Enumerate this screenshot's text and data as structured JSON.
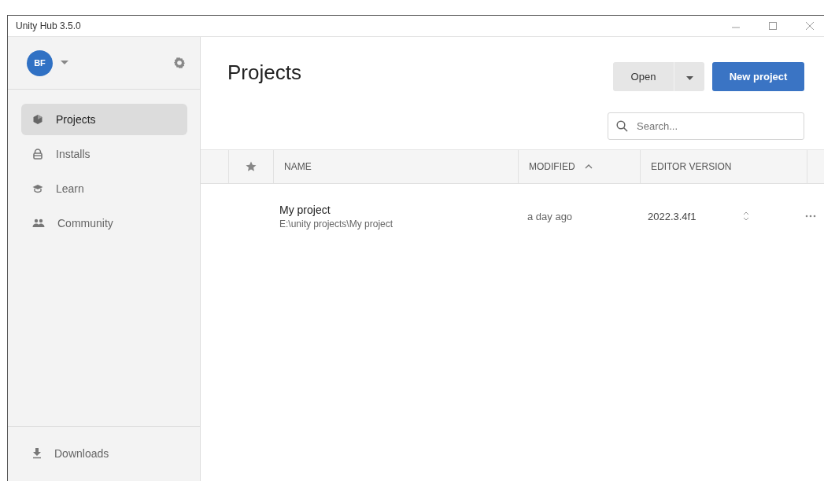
{
  "window": {
    "title": "Unity Hub 3.5.0"
  },
  "account": {
    "initials": "BF"
  },
  "sidebar": {
    "items": [
      {
        "label": "Projects",
        "selected": true
      },
      {
        "label": "Installs",
        "selected": false
      },
      {
        "label": "Learn",
        "selected": false
      },
      {
        "label": "Community",
        "selected": false
      }
    ],
    "footer": {
      "label": "Downloads"
    }
  },
  "page": {
    "title": "Projects",
    "open_button": "Open",
    "new_button": "New project",
    "search": {
      "placeholder": "Search..."
    }
  },
  "table": {
    "columns": [
      {
        "label": "NAME",
        "sorted": false
      },
      {
        "label": "MODIFIED",
        "sorted": true
      },
      {
        "label": "EDITOR VERSION",
        "sorted": false
      }
    ],
    "rows": [
      {
        "name": "My project",
        "path": "E:\\unity projects\\My project",
        "modified": "a day ago",
        "version": "2022.3.4f1"
      }
    ]
  }
}
